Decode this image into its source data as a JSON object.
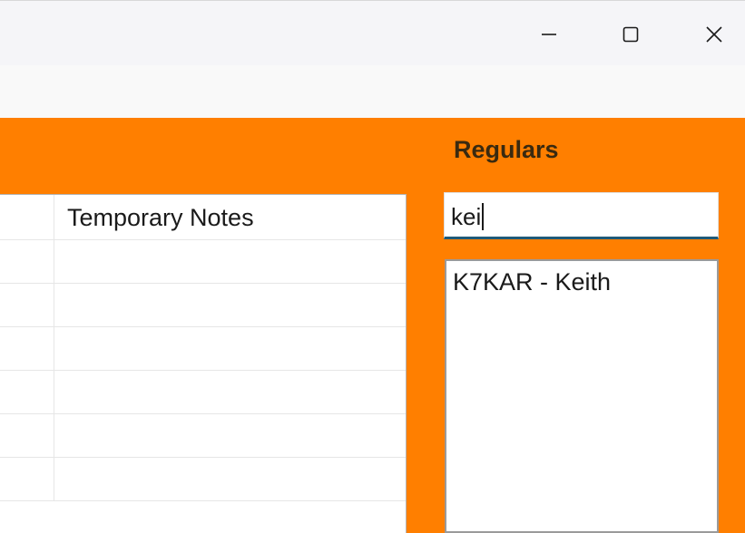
{
  "window": {
    "controls": {
      "minimize_icon": "minimize-icon",
      "maximize_icon": "maximize-icon",
      "close_icon": "close-icon"
    }
  },
  "theme": {
    "accent": "#ff7f00",
    "search_underline": "#1f5a78"
  },
  "grid": {
    "columns": [
      "",
      "Temporary Notes"
    ],
    "rows": [
      [
        "",
        ""
      ],
      [
        "",
        ""
      ],
      [
        "",
        ""
      ],
      [
        "",
        ""
      ],
      [
        "",
        ""
      ],
      [
        "",
        ""
      ]
    ]
  },
  "regulars": {
    "title": "Regulars",
    "search_value": "kei",
    "results": [
      "K7KAR - Keith"
    ]
  }
}
